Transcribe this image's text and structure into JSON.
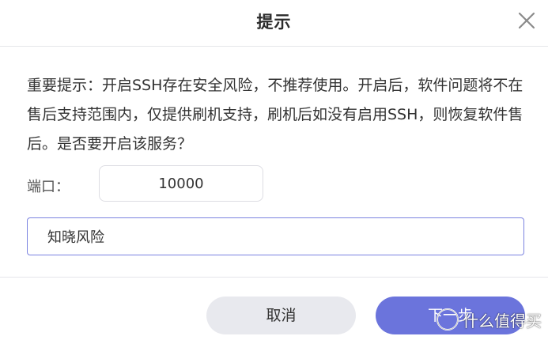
{
  "dialog": {
    "title": "提示",
    "message": "重要提示：开启SSH存在安全风险，不推荐使用。开启后，软件问题将不在售后支持范围内，仅提供刷机支持，刷机后如没有启用SSH，则恢复软件售后。是否要开启该服务？",
    "port_label": "端口：",
    "port_value": "10000",
    "confirm_value": "知晓风险",
    "cancel_label": "取消",
    "next_label": "下一步"
  },
  "watermark": {
    "text": "什么值得买",
    "logo_char": "值"
  },
  "colors": {
    "accent": "#6b74dc",
    "input_focus_border": "#7b83e0",
    "cancel_bg": "#e8e9ee",
    "divider": "#e5e6ea"
  },
  "icons": {
    "close": "close-icon",
    "watermark_logo": "smzdm-logo-icon"
  }
}
